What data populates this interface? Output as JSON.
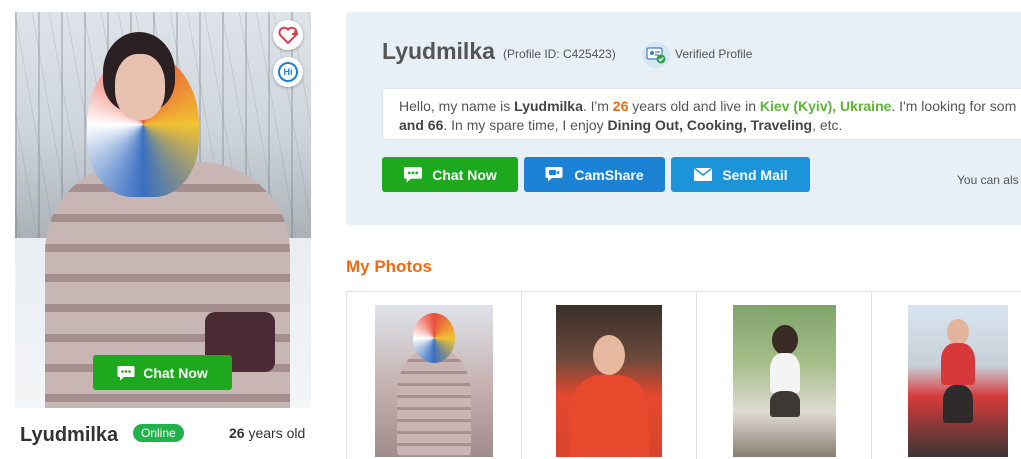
{
  "card": {
    "name": "Lyudmilka",
    "status": "Online",
    "age_number": "26",
    "age_suffix": " years old",
    "chat_button": "Chat Now",
    "hi_label": "Hi"
  },
  "profile": {
    "name": "Lyudmilka",
    "profile_id": "(Profile ID: C425423)",
    "verified_label": "Verified Profile"
  },
  "bio": {
    "p1": "Hello, my name is ",
    "name": "Lyudmilka",
    "p2": ". I'm ",
    "age": "26",
    "p3": " years old and live in ",
    "location": "Kiev (Kyiv), Ukraine",
    "p4": ". I'm looking for som",
    "age_max": "and 66",
    "p5": ". In my spare time, I enjoy ",
    "hobbies": "Dining Out, Cooking, Traveling",
    "p6": ", etc."
  },
  "actions": {
    "chat": "Chat Now",
    "camshare": "CamShare",
    "mail": "Send Mail",
    "also_text": "You can als"
  },
  "photos": {
    "heading": "My Photos"
  },
  "colors": {
    "green": "#1ea81e",
    "blue": "#1b82d6",
    "orange": "#f26a0f",
    "online": "#22b14c",
    "panel_bg": "#e8f0f7"
  }
}
